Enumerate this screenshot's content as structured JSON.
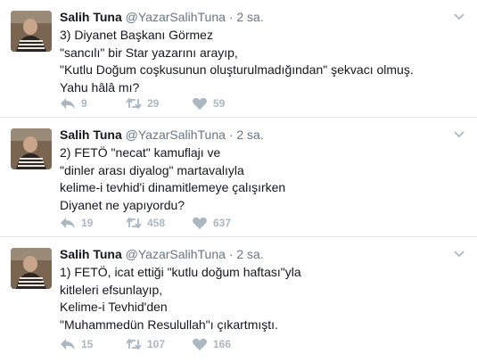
{
  "tweets": [
    {
      "name": "Salih Tuna",
      "handle": "@YazarSalihTuna",
      "separator": "·",
      "time": "2 sa.",
      "text": "3) Diyanet Başkanı Görmez\n\"sancılı\" bir Star yazarını arayıp,\n\"Kutlu Doğum coşkusunun oluşturulmadığından\" şekvacı olmuş.\nYahu hâlâ mı?",
      "replies": "9",
      "retweets": "29",
      "likes": "59"
    },
    {
      "name": "Salih Tuna",
      "handle": "@YazarSalihTuna",
      "separator": "·",
      "time": "2 sa.",
      "text": "2) FETÖ \"necat\" kamuflajı ve\n\"dinler arası diyalog\" martavalıyla\nkelime-i tevhid'i dinamitlemeye çalışırken\nDiyanet ne yapıyordu?",
      "replies": "19",
      "retweets": "458",
      "likes": "637"
    },
    {
      "name": "Salih Tuna",
      "handle": "@YazarSalihTuna",
      "separator": "·",
      "time": "2 sa.",
      "text": "1) FETÖ, icat ettiği \"kutlu doğum haftası\"yla\nkitleleri efsunlayıp,\nKelime-i Tevhid'den\n\"Muhammedün Resulullah\"ı çıkartmıştı.",
      "replies": "15",
      "retweets": "107",
      "likes": "166"
    }
  ],
  "icons": {
    "reply": "reply-icon",
    "retweet": "retweet-icon",
    "like": "heart-icon",
    "menu": "chevron-down-icon"
  },
  "colors": {
    "name": "#14171a",
    "meta": "#657786",
    "action": "#aab8c2",
    "divider": "#e1e8ed"
  }
}
